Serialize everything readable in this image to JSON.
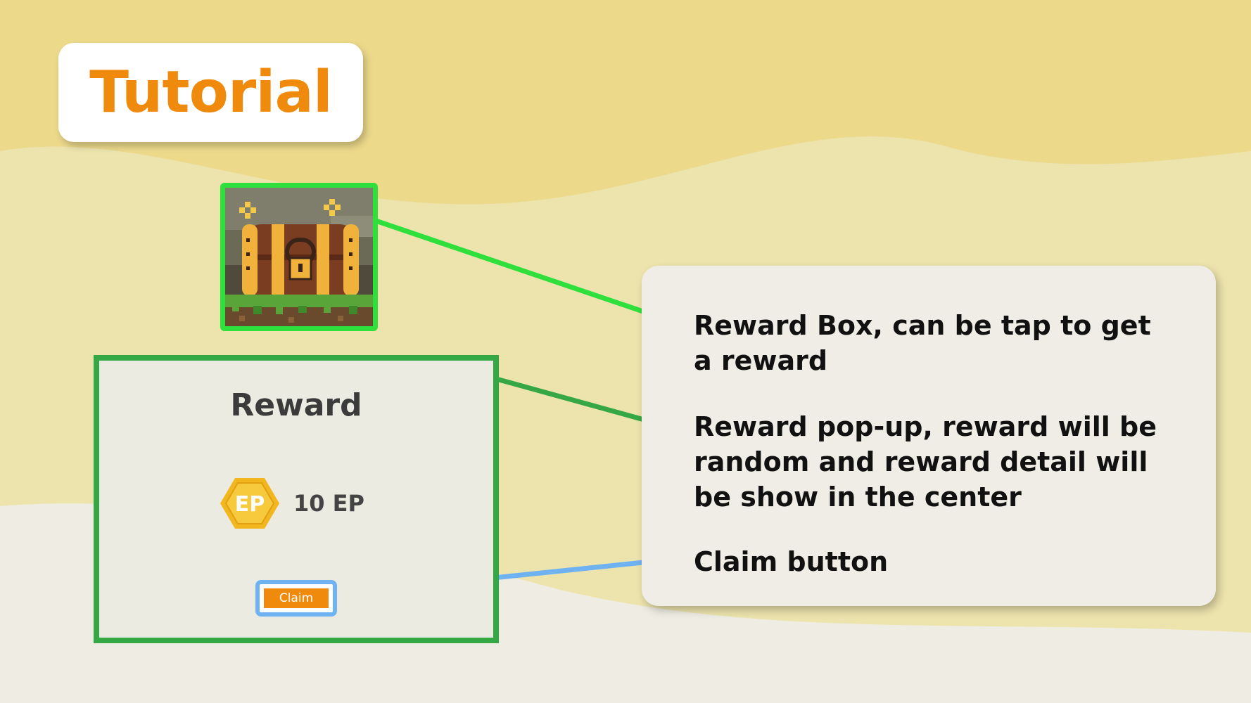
{
  "header": {
    "title": "Tutorial"
  },
  "colors": {
    "title_orange": "#f08a0c",
    "chest_highlight": "#2fe03c",
    "popup_highlight": "#36a745",
    "claim_highlight": "#6eb2f2",
    "wave_top": "#ecd98a",
    "wave_mid": "#ede4ad",
    "wave_low": "#efe8c9",
    "background": "#efede3"
  },
  "reward_box": {
    "icon": "treasure-chest-icon"
  },
  "popup": {
    "title": "Reward",
    "currency_icon": "ep-badge-icon",
    "currency_symbol": "EP",
    "amount": "10 EP",
    "claim_label": "Claim"
  },
  "notes": [
    {
      "text": "Reward Box, can be tap to get a reward"
    },
    {
      "text": "Reward pop-up, reward will be random and reward detail will be show in the center"
    },
    {
      "text": "Claim button"
    }
  ]
}
